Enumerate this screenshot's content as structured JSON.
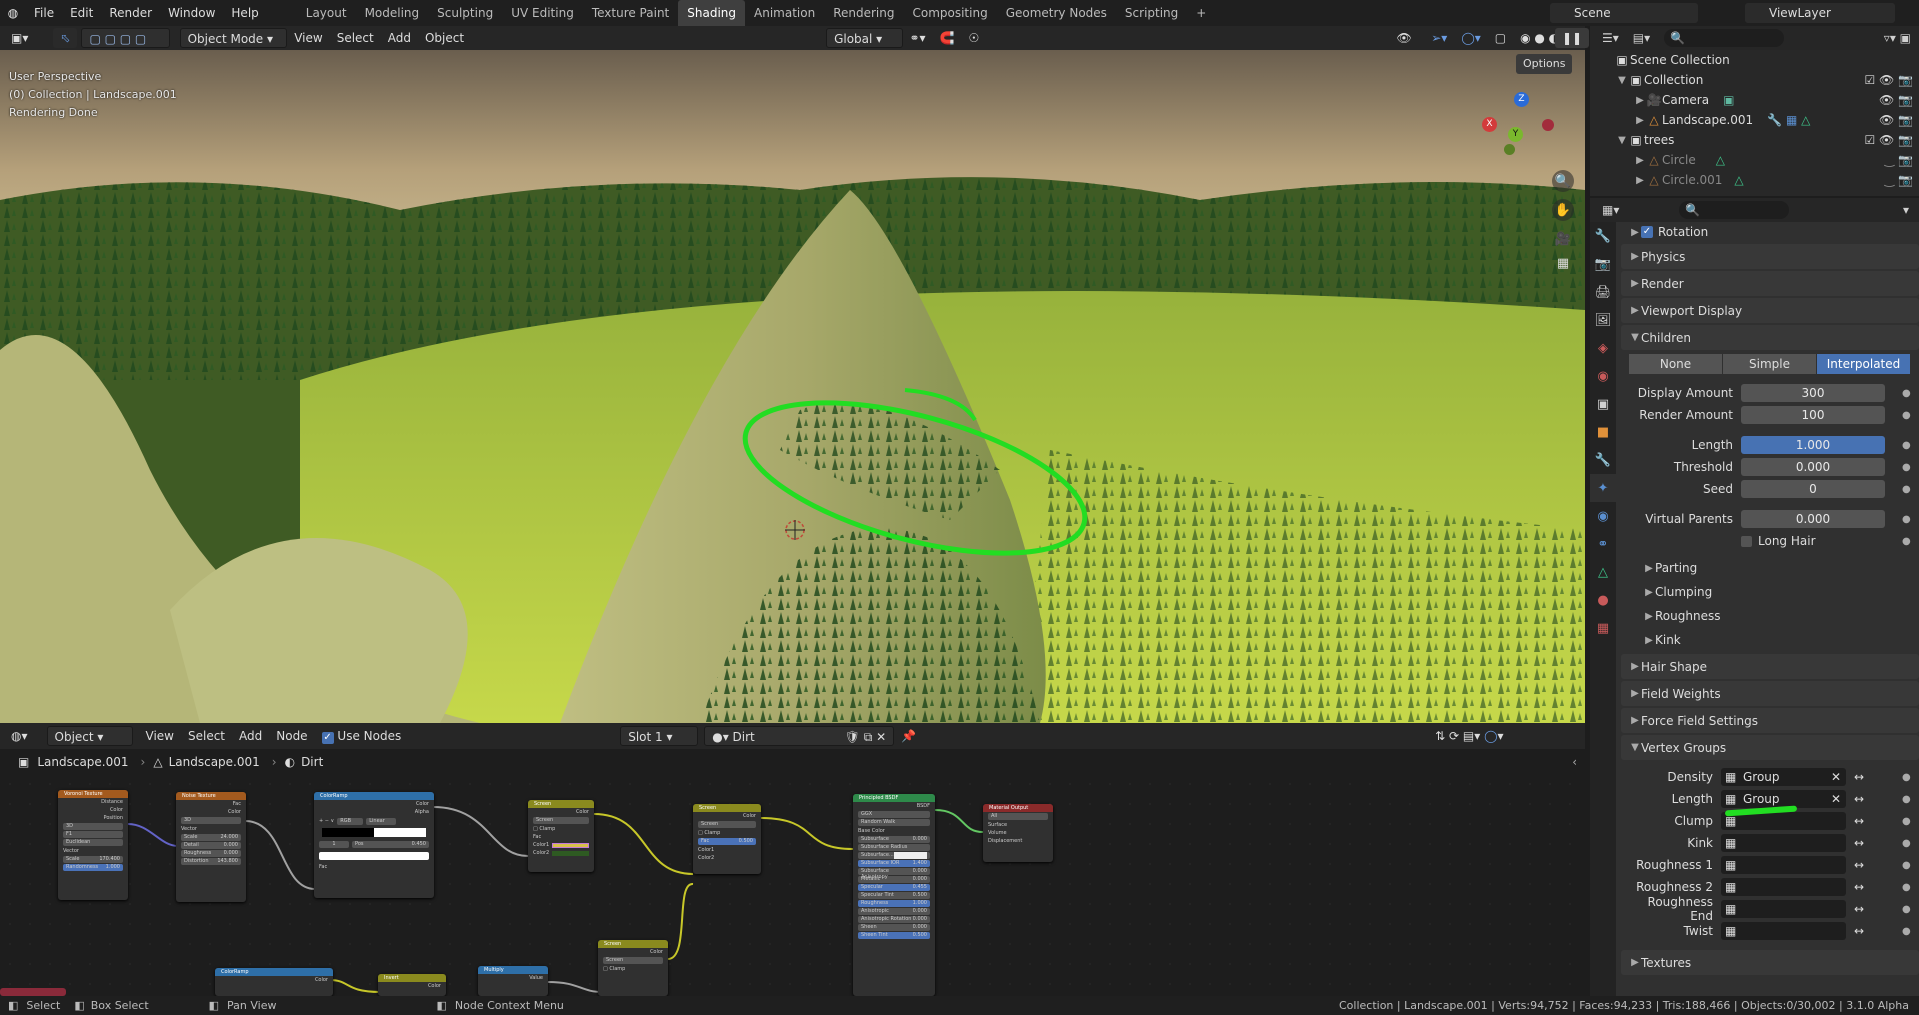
{
  "topbar": {
    "menus": [
      "File",
      "Edit",
      "Render",
      "Window",
      "Help"
    ],
    "workspaces": [
      "Layout",
      "Modeling",
      "Sculpting",
      "UV Editing",
      "Texture Paint",
      "Shading",
      "Animation",
      "Rendering",
      "Compositing",
      "Geometry Nodes",
      "Scripting"
    ],
    "active_workspace": "Shading",
    "add_tab": "+",
    "scene": "Scene",
    "view_layer": "ViewLayer"
  },
  "viewport_header": {
    "mode": "Object Mode",
    "menus": [
      "View",
      "Select",
      "Add",
      "Object"
    ],
    "orientation": "Global",
    "options": "Options"
  },
  "viewport": {
    "perspective": "User Perspective",
    "collection_line": "(0) Collection | Landscape.001",
    "render_status": "Rendering Done",
    "gizmo": {
      "x": "X",
      "y": "Y",
      "z": "Z"
    }
  },
  "node_header": {
    "type": "Object",
    "menus": [
      "View",
      "Select",
      "Add",
      "Node"
    ],
    "use_nodes": "Use Nodes",
    "slot": "Slot 1",
    "material": "Dirt"
  },
  "breadcrumb": [
    "Landscape.001",
    "Landscape.001",
    "Dirt"
  ],
  "nodes": {
    "voronoi": {
      "title": "Voronoi Texture",
      "outputs": [
        "Distance",
        "Color",
        "Position"
      ],
      "selects": [
        "3D",
        "F1",
        "Euclidean"
      ],
      "inputs": [
        "Vector",
        "Scale",
        "Randomness"
      ],
      "values": [
        "170.400",
        "1.000"
      ]
    },
    "noise": {
      "title": "Noise Texture",
      "outputs": [
        "Fac",
        "Color"
      ],
      "selects": [
        "3D"
      ],
      "inputs": [
        "Vector",
        "Scale",
        "Detail",
        "Roughness",
        "Distortion"
      ],
      "values": [
        "24.000",
        "0.000",
        "0.000",
        "143.800"
      ]
    },
    "colorramp": {
      "title": "ColorRamp",
      "outputs": [
        "Color",
        "Alpha"
      ],
      "mode": "RGB",
      "interp": "Linear",
      "pos_label": "Pos",
      "index": "1",
      "pos": "0.450",
      "input": "Fac"
    },
    "screen1": {
      "title": "Screen",
      "outputs": [
        "Color"
      ],
      "blend": "Screen",
      "clamp": "Clamp",
      "inputs": [
        "Fac",
        "Color1",
        "Color2"
      ]
    },
    "screen2": {
      "title": "Screen",
      "outputs": [
        "Color"
      ],
      "blend": "Screen",
      "clamp": "Clamp",
      "fac_label": "Fac",
      "fac": "0.500",
      "inputs": [
        "Color1",
        "Color2"
      ]
    },
    "principled": {
      "title": "Principled BSDF",
      "output": "BSDF",
      "dist": "GGX",
      "sss": "Random Walk",
      "rows": [
        "Base Color",
        "Subsurface",
        "Subsurface Radius",
        "Subsurface...",
        "Subsurface IOR",
        "Subsurface Anisotropy",
        "Metallic",
        "Specular",
        "Specular Tint",
        "Roughness",
        "Anisotropic",
        "Anisotropic Rotation",
        "Sheen",
        "Sheen Tint"
      ],
      "values": [
        "0.000",
        "",
        "",
        "1.400",
        "0.000",
        "0.000",
        "0.455",
        "0.500",
        "1.000",
        "0.000",
        "0.000",
        "0.000",
        "0.500"
      ]
    },
    "output": {
      "title": "Material Output",
      "target": "All",
      "inputs": [
        "Surface",
        "Volume",
        "Displacement"
      ]
    },
    "colorramp2": {
      "title": "ColorRamp",
      "output": "Color"
    },
    "invert": {
      "title": "Invert",
      "output": "Color"
    },
    "multiply": {
      "title": "Multiply",
      "output": "Value"
    },
    "screen3": {
      "title": "Screen",
      "output": "Color",
      "blend": "Screen",
      "clamp": "Clamp"
    }
  },
  "outliner": {
    "root": "Scene Collection",
    "items": [
      {
        "name": "Collection",
        "level": 1
      },
      {
        "name": "Camera",
        "level": 2
      },
      {
        "name": "Landscape.001",
        "level": 2
      },
      {
        "name": "trees",
        "level": 1
      },
      {
        "name": "Circle",
        "level": 2
      },
      {
        "name": "Circle.001",
        "level": 2
      }
    ]
  },
  "properties": {
    "rotation": "Rotation",
    "panels_top": [
      "Physics",
      "Render",
      "Viewport Display"
    ],
    "children": {
      "title": "Children",
      "modes": [
        "None",
        "Simple",
        "Interpolated"
      ],
      "active_mode": "Interpolated",
      "fields": [
        {
          "label": "Display Amount",
          "value": "300"
        },
        {
          "label": "Render Amount",
          "value": "100"
        },
        {
          "label": "Length",
          "value": "1.000"
        },
        {
          "label": "Threshold",
          "value": "0.000"
        },
        {
          "label": "Seed",
          "value": "0"
        },
        {
          "label": "Virtual Parents",
          "value": "0.000"
        }
      ],
      "long_hair": "Long Hair",
      "subpanels": [
        "Parting",
        "Clumping",
        "Roughness",
        "Kink"
      ]
    },
    "panels_mid": [
      "Hair Shape",
      "Field Weights",
      "Force Field Settings"
    ],
    "vertex_groups": {
      "title": "Vertex Groups",
      "rows": [
        {
          "label": "Density",
          "value": "Group"
        },
        {
          "label": "Length",
          "value": "Group"
        },
        {
          "label": "Clump",
          "value": ""
        },
        {
          "label": "Kink",
          "value": ""
        },
        {
          "label": "Roughness 1",
          "value": ""
        },
        {
          "label": "Roughness 2",
          "value": ""
        },
        {
          "label": "Roughness End",
          "value": ""
        },
        {
          "label": "Twist",
          "value": ""
        }
      ]
    },
    "textures": "Textures"
  },
  "statusbar": {
    "select": "Select",
    "box_select": "Box Select",
    "pan_view": "Pan View",
    "context_menu": "Node Context Menu",
    "stats": "Collection | Landscape.001 | Verts:94,752 | Faces:94,233 | Tris:188,466 | Objects:0/30,002 | 3.1.0 Alpha"
  },
  "colors": {
    "accent": "#4772b3",
    "annotation": "#22dd22",
    "active_ws": "#3f3f3f"
  }
}
